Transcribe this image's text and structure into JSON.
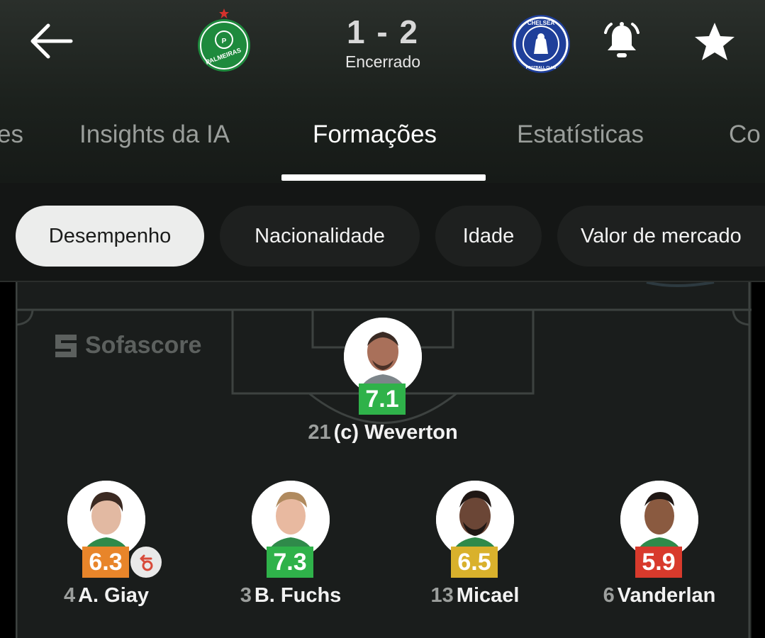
{
  "header": {
    "score": "1 - 2",
    "status": "Encerrado",
    "home_team": {
      "crest_icon": "palmeiras-crest",
      "crest_text": "PALMEIRAS",
      "color": "#1e8a3d"
    },
    "away_team": {
      "crest_icon": "chelsea-crest",
      "crest_text": "CHELSEA FOOTBALL CLUB",
      "color": "#1f3f9a"
    }
  },
  "tabs": [
    {
      "label": "es"
    },
    {
      "label": "Insights da IA"
    },
    {
      "label": "Formações",
      "active": true
    },
    {
      "label": "Estatísticas"
    },
    {
      "label": "Co"
    }
  ],
  "chips": [
    {
      "label": "Desempenho",
      "selected": true
    },
    {
      "label": "Nacionalidade"
    },
    {
      "label": "Idade"
    },
    {
      "label": "Valor de mercado"
    }
  ],
  "pitch": {
    "watermark": "Sofascore"
  },
  "players": [
    {
      "number": "21",
      "name": "(c) Weverton",
      "rating": "7.1",
      "rating_color": "#2fb24a"
    },
    {
      "number": "4",
      "name": "A. Giay",
      "rating": "6.3",
      "rating_color": "#e8852a",
      "substituted": true
    },
    {
      "number": "3",
      "name": "B. Fuchs",
      "rating": "7.3",
      "rating_color": "#2fb24a"
    },
    {
      "number": "13",
      "name": "Micael",
      "rating": "6.5",
      "rating_color": "#d9b12c"
    },
    {
      "number": "6",
      "name": "Vanderlan",
      "rating": "5.9",
      "rating_color": "#d83a2c"
    }
  ]
}
